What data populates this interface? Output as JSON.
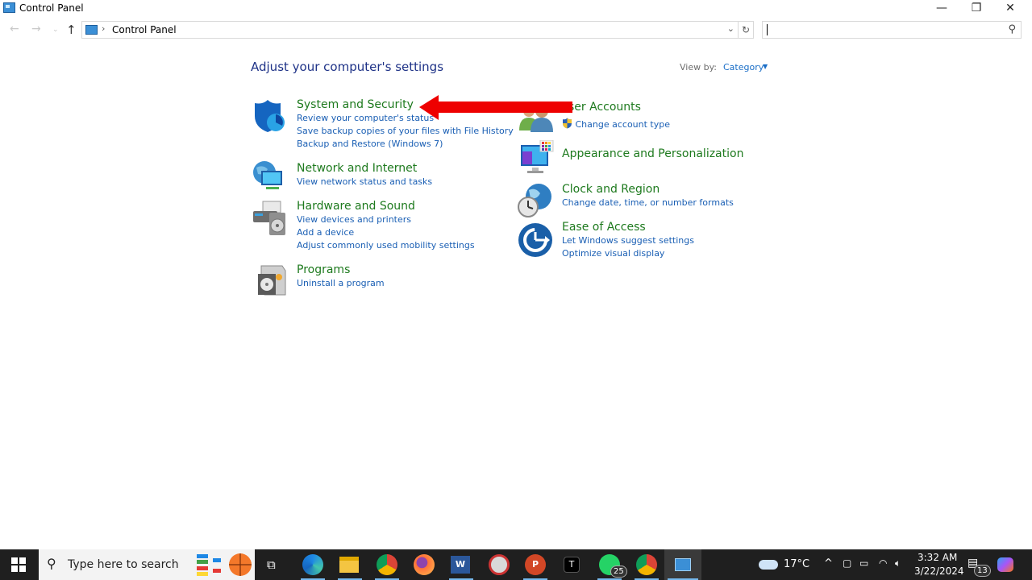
{
  "window": {
    "title": "Control Panel",
    "minimize_glyph": "—",
    "maximize_glyph": "❐",
    "close_glyph": "✕"
  },
  "navigation": {
    "back_glyph": "←",
    "forward_glyph": "→",
    "recent_glyph": "⌄",
    "up_glyph": "↑",
    "breadcrumb_separator": "›",
    "breadcrumb": "Control Panel",
    "dropdown_glyph": "⌄",
    "refresh_glyph": "↻",
    "search_placeholder": "",
    "search_glyph": "⚲"
  },
  "content": {
    "heading": "Adjust your computer's settings",
    "view_by_label": "View by:",
    "view_by_value": "Category",
    "view_by_arrow": "▼",
    "categories_left": [
      {
        "title": "System and Security",
        "icon": "shield-icon",
        "links": [
          "Review your computer's status",
          "Save backup copies of your files with File History",
          "Backup and Restore (Windows 7)"
        ]
      },
      {
        "title": "Network and Internet",
        "icon": "network-icon",
        "links": [
          "View network status and tasks"
        ]
      },
      {
        "title": "Hardware and Sound",
        "icon": "printer-icon",
        "links": [
          "View devices and printers",
          "Add a device",
          "Adjust commonly used mobility settings"
        ]
      },
      {
        "title": "Programs",
        "icon": "programs-icon",
        "links": [
          "Uninstall a program"
        ]
      }
    ],
    "categories_right": [
      {
        "title": "User Accounts",
        "title_visible": "ser Accounts",
        "icon": "users-icon",
        "links": [
          "Change account type"
        ]
      },
      {
        "title": "Appearance and Personalization",
        "icon": "monitor-icon",
        "links": []
      },
      {
        "title": "Clock and Region",
        "icon": "clock-globe-icon",
        "links": [
          "Change date, time, or number formats"
        ]
      },
      {
        "title": "Ease of Access",
        "icon": "ease-of-access-icon",
        "links": [
          "Let Windows suggest settings",
          "Optimize visual display"
        ]
      }
    ],
    "annotation": {
      "type": "red-arrow",
      "points_to": "System and Security",
      "color": "#ee0000"
    }
  },
  "colors": {
    "category_title": "#1e7a1e",
    "link": "#1a5fb4",
    "heading": "#1e3287",
    "taskbar": "#1f1f1f"
  },
  "taskbar": {
    "search_placeholder": "Type here to search",
    "apps": [
      "Task View",
      "Microsoft Edge",
      "File Explorer",
      "Google Chrome",
      "Firefox",
      "Microsoft Word",
      "Snipping Tool",
      "PowerPoint",
      "Terminal app",
      "WhatsApp",
      "Google Chrome (profile)",
      "Control Panel"
    ],
    "whatsapp_badge": "25",
    "weather": "17°C",
    "tray_chevron": "^",
    "time": "3:32 AM",
    "date": "3/22/2024",
    "notifications_badge": "13"
  }
}
